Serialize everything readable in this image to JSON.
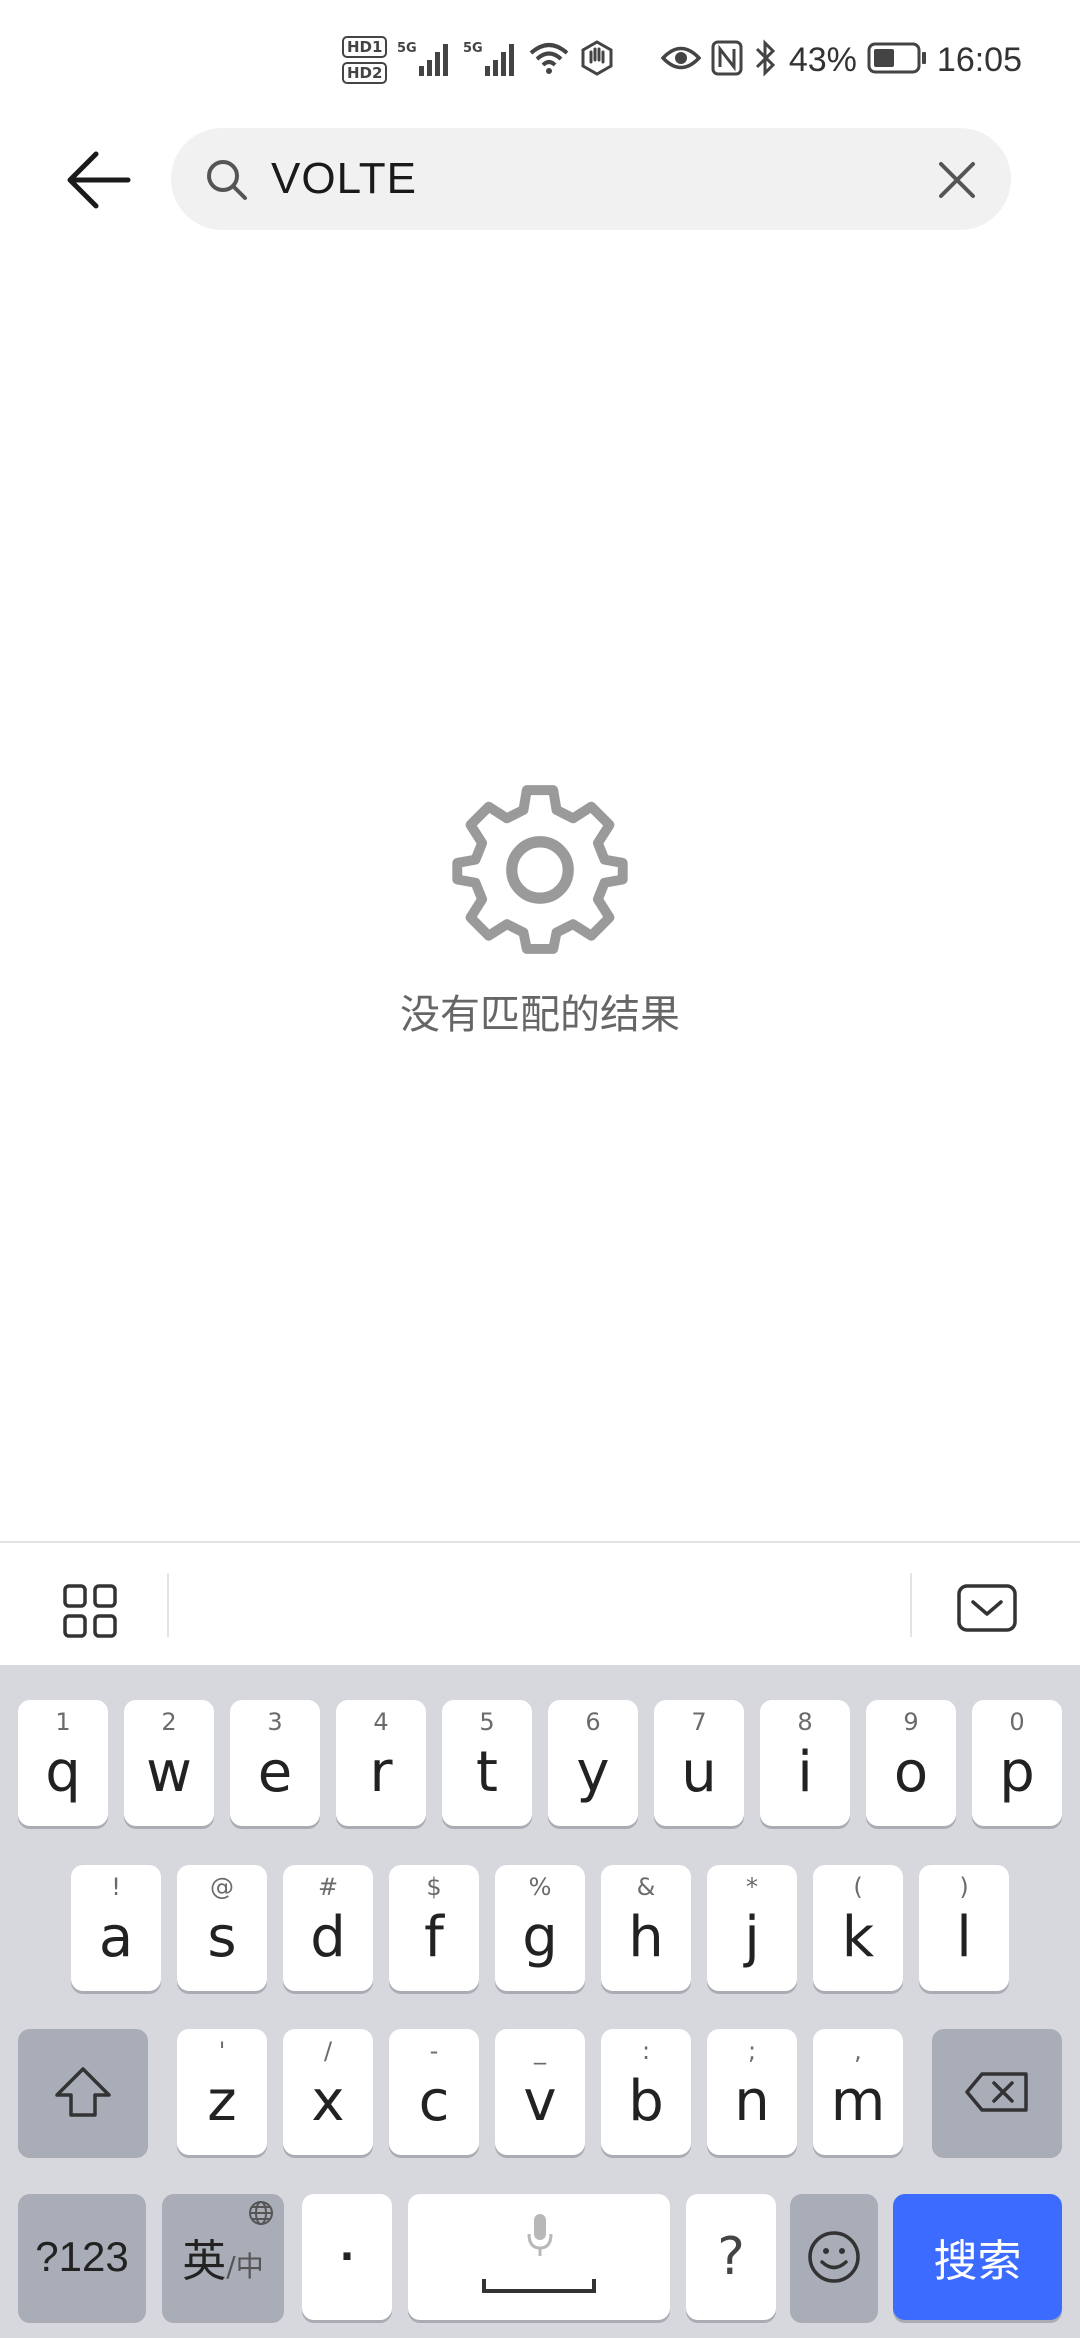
{
  "status_bar": {
    "sim1_badge": "HD1",
    "sim2_badge": "HD2",
    "net1": "5G",
    "net2": "5G",
    "battery": "43%",
    "time": "16:05",
    "icons": [
      "signal-icon",
      "wifi-icon",
      "hand-icon",
      "eye-icon",
      "nfc-icon",
      "bluetooth-icon",
      "battery-icon"
    ]
  },
  "search": {
    "value": "VOLTE"
  },
  "empty_state": {
    "icon": "gear-icon",
    "text": "没有匹配的结果"
  },
  "keyboard": {
    "row1": [
      {
        "hint": "1",
        "key": "q"
      },
      {
        "hint": "2",
        "key": "w"
      },
      {
        "hint": "3",
        "key": "e"
      },
      {
        "hint": "4",
        "key": "r"
      },
      {
        "hint": "5",
        "key": "t"
      },
      {
        "hint": "6",
        "key": "y"
      },
      {
        "hint": "7",
        "key": "u"
      },
      {
        "hint": "8",
        "key": "i"
      },
      {
        "hint": "9",
        "key": "o"
      },
      {
        "hint": "0",
        "key": "p"
      }
    ],
    "row2": [
      {
        "hint": "!",
        "key": "a"
      },
      {
        "hint": "@",
        "key": "s"
      },
      {
        "hint": "#",
        "key": "d"
      },
      {
        "hint": "$",
        "key": "f"
      },
      {
        "hint": "%",
        "key": "g"
      },
      {
        "hint": "&",
        "key": "h"
      },
      {
        "hint": "*",
        "key": "j"
      },
      {
        "hint": "(",
        "key": "k"
      },
      {
        "hint": ")",
        "key": "l"
      }
    ],
    "row3": [
      {
        "hint": "'",
        "key": "z"
      },
      {
        "hint": "/",
        "key": "x"
      },
      {
        "hint": "-",
        "key": "c"
      },
      {
        "hint": "_",
        "key": "v"
      },
      {
        "hint": ":",
        "key": "b"
      },
      {
        "hint": ";",
        "key": "n"
      },
      {
        "hint": ",",
        "key": "m"
      }
    ],
    "numbers_key": "?123",
    "lang_key_main": "英",
    "lang_key_sub": "/中",
    "dot_key": "·",
    "question_key": "?",
    "search_key": "搜索"
  },
  "colors": {
    "accent": "#3b6bff",
    "keyboard_bg": "#d6d8de",
    "search_bg": "#f1f1f1",
    "empty_icon": "#9a9a9a"
  }
}
